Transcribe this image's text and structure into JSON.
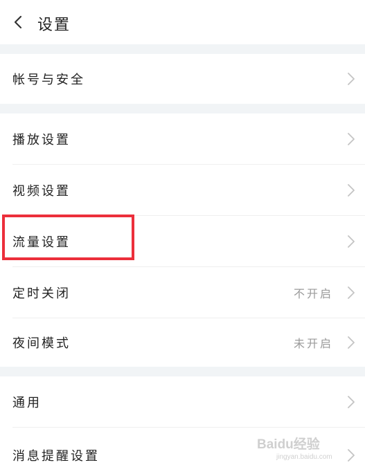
{
  "header": {
    "title": "设置",
    "back_icon": "chevron-left-icon"
  },
  "sections": [
    {
      "items": [
        {
          "label": "帐号与安全",
          "value": ""
        }
      ]
    },
    {
      "items": [
        {
          "label": "播放设置",
          "value": ""
        },
        {
          "label": "视频设置",
          "value": ""
        },
        {
          "label": "流量设置",
          "value": ""
        },
        {
          "label": "定时关闭",
          "value": "不开启"
        },
        {
          "label": "夜间模式",
          "value": "未开启"
        }
      ]
    },
    {
      "items": [
        {
          "label": "通用",
          "value": ""
        },
        {
          "label": "消息提醒设置",
          "value": ""
        }
      ]
    }
  ],
  "highlight": {
    "color": "#ec2f3b",
    "target": "流量设置"
  },
  "watermark": {
    "brand": "Baidu经验",
    "url": "jingyan.baidu.com"
  },
  "colors": {
    "background": "#ffffff",
    "section_gap": "#f1f4f6",
    "text": "#222222",
    "secondary_text": "#9a9a9a",
    "chevron": "#c4c4c4"
  }
}
